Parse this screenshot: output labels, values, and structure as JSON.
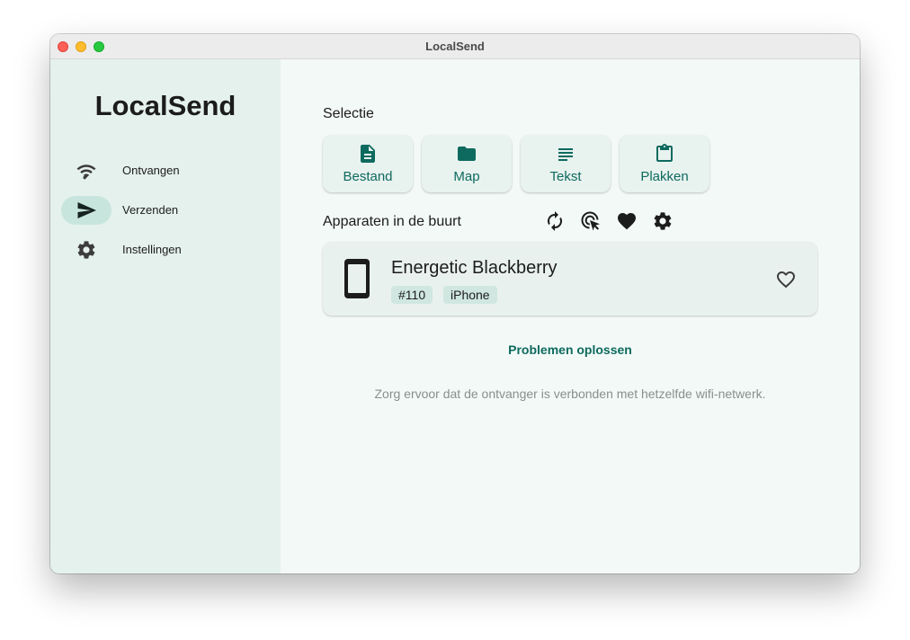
{
  "window": {
    "title": "LocalSend"
  },
  "sidebar": {
    "app_name": "LocalSend",
    "items": [
      {
        "label": "Ontvangen",
        "icon": "wifi-icon",
        "active": false
      },
      {
        "label": "Verzenden",
        "icon": "send-icon",
        "active": true
      },
      {
        "label": "Instellingen",
        "icon": "gear-icon",
        "active": false
      }
    ]
  },
  "main": {
    "selection_title": "Selectie",
    "selection_buttons": [
      {
        "label": "Bestand",
        "icon": "file-icon"
      },
      {
        "label": "Map",
        "icon": "folder-icon"
      },
      {
        "label": "Tekst",
        "icon": "text-icon"
      },
      {
        "label": "Plakken",
        "icon": "clipboard-icon"
      }
    ],
    "nearby_title": "Apparaten in de buurt",
    "nearby_tools": [
      "refresh-icon",
      "scan-target-icon",
      "favorites-heart-icon",
      "settings-gear-icon"
    ],
    "device": {
      "name": "Energetic Blackberry",
      "tags": [
        "#110",
        "iPhone"
      ],
      "icon": "phone-icon"
    },
    "troubleshoot_link": "Problemen oplossen",
    "hint": "Zorg ervoor dat de ontvanger is verbonden met hetzelfde wifi-netwerk."
  },
  "colors": {
    "accent": "#0e6a5e",
    "sidebar_bg": "#e5f1ed",
    "main_bg": "#f3f9f7",
    "active_pill": "#c8e5dd"
  }
}
